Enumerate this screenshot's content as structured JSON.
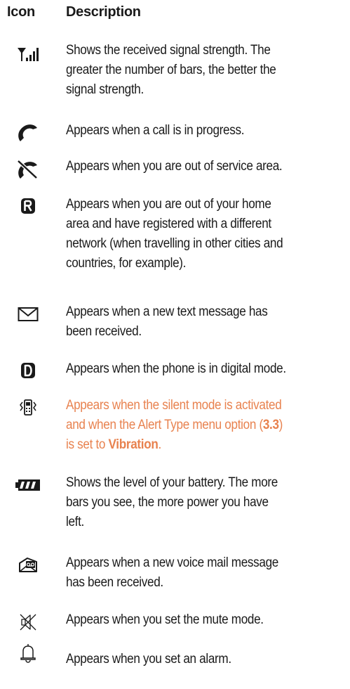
{
  "header": {
    "icon_col": "Icon",
    "desc_col": "Description"
  },
  "rows": [
    {
      "icon": "signal-strength-icon",
      "lines": [
        "Shows the received signal strength. The",
        "greater the number of bars, the better the",
        "signal strength."
      ]
    },
    {
      "icon": "call-in-progress-icon",
      "lines": [
        "Appears when a call is in progress."
      ]
    },
    {
      "icon": "no-service-icon",
      "lines": [
        "Appears when you are out of service area."
      ]
    },
    {
      "icon": "roaming-icon",
      "lines": [
        "Appears when you are out of your home",
        "area and have registered with a different",
        "network (when travelling in other cities and",
        "countries, for example)."
      ]
    },
    {
      "icon": "text-message-icon",
      "lines": [
        "Appears when a new text message has",
        "been received."
      ]
    },
    {
      "icon": "digital-mode-icon",
      "lines": [
        "Appears when the phone is in digital mode."
      ]
    },
    {
      "icon": "vibration-icon",
      "color": "#e8824f",
      "line1": "Appears when the silent mode is activated",
      "line2_a": "and when the Alert Type menu option (",
      "line2_b": "3.3",
      "line2_c": ")",
      "line3_a": "is set to ",
      "line3_b": "Vibration",
      "line3_c": "."
    },
    {
      "icon": "battery-icon",
      "lines": [
        "Shows the level of your battery. The more",
        "bars you see, the more power you have",
        "left."
      ]
    },
    {
      "icon": "voice-mail-icon",
      "lines": [
        "Appears when a new voice mail message",
        "has been received."
      ]
    },
    {
      "icon": "mute-icon",
      "lines": [
        "Appears when you set the mute mode."
      ]
    },
    {
      "icon": "alarm-icon",
      "lines": [
        "Appears when you set an alarm."
      ]
    }
  ]
}
